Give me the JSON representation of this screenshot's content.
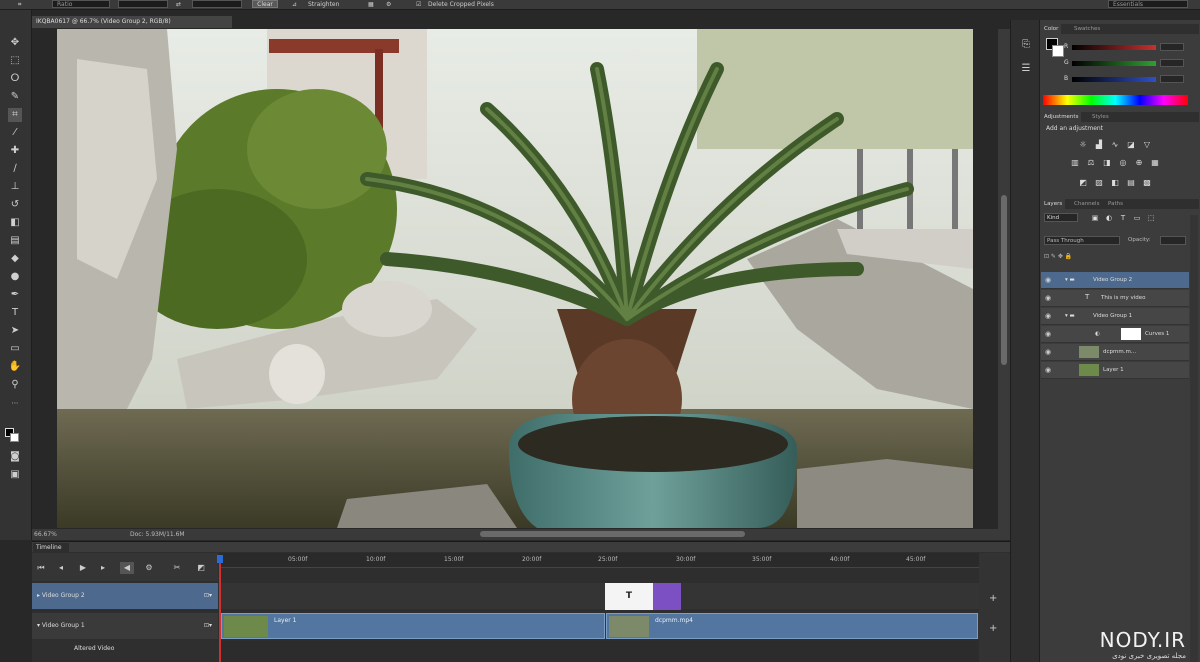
{
  "options_bar": {
    "ratio_label": "Ratio",
    "clear_label": "Clear",
    "straighten_label": "Straighten",
    "delete_cropped_label": "Delete Cropped Pixels",
    "workspace_label": "Essentials"
  },
  "document": {
    "tab_title": "IKQBA0617 @ 66.7% (Video Group 2, RGB/8)",
    "zoom": "66.67%",
    "doc_info": "Doc: 5.93M/11.6M"
  },
  "timeline": {
    "tab_label": "Timeline",
    "ruler_ticks": [
      "05:00f",
      "10:00f",
      "15:00f",
      "20:00f",
      "25:00f",
      "30:00f",
      "35:00f",
      "40:00f",
      "45:00f"
    ],
    "tracks": [
      {
        "label": "Video Group 2"
      },
      {
        "label": "Video Group 1"
      },
      {
        "label": "Altered Video"
      }
    ],
    "clips": {
      "layer1": "Layer 1",
      "clip2": "dcpmm.mp4",
      "text_clip": "T"
    }
  },
  "panels": {
    "color_tabs": [
      "Color",
      "Swatches"
    ],
    "sliders": [
      {
        "label": "R",
        "color": "#c83030"
      },
      {
        "label": "G",
        "color": "#30a030"
      },
      {
        "label": "B",
        "color": "#3050c8"
      }
    ],
    "adjust_tabs": [
      "Adjustments",
      "Styles"
    ],
    "adjust_heading": "Add an adjustment",
    "layers_tabs": [
      "Layers",
      "Channels",
      "Paths"
    ],
    "kind_label": "Kind",
    "blend_mode": "Pass Through",
    "opacity_label": "Opacity:",
    "layers": [
      {
        "name": "Video Group 2",
        "selected": true
      },
      {
        "name": "This is my video",
        "selected": false
      },
      {
        "name": "Video Group 1",
        "selected": false
      },
      {
        "name": "Curves 1",
        "selected": false
      },
      {
        "name": "dcpmm.m...",
        "selected": false
      },
      {
        "name": "Layer 1",
        "selected": false
      }
    ]
  },
  "watermark": {
    "brand": "NODY.IR",
    "tagline": "مجله تصویری خبری نودی"
  }
}
